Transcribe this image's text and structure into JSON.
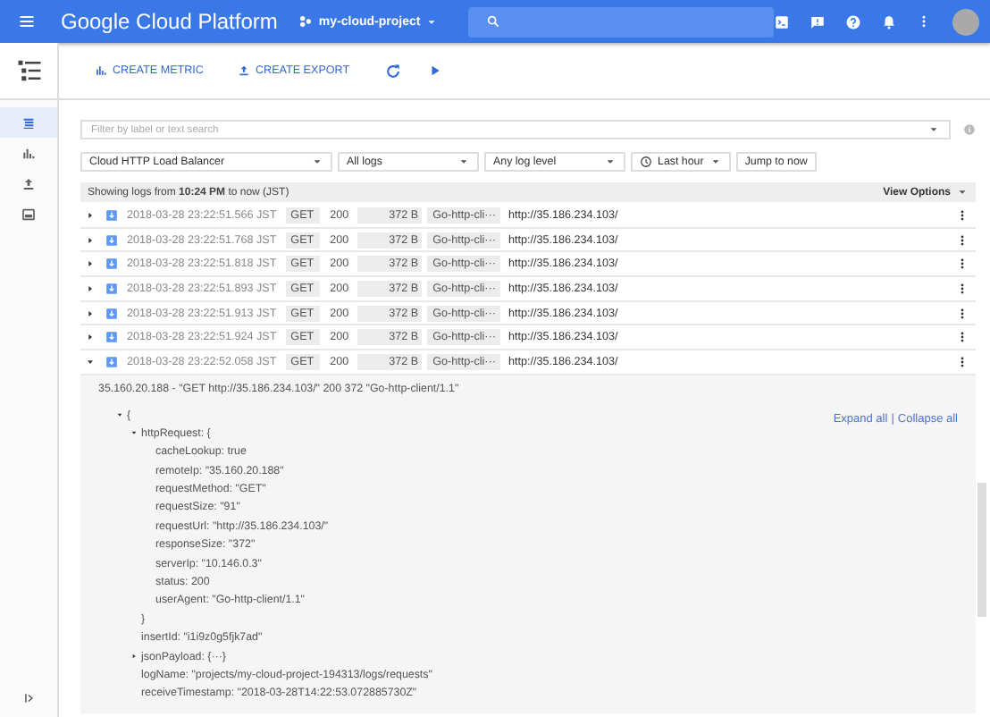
{
  "header": {
    "title": "Google Cloud Platform",
    "project": "my-cloud-project"
  },
  "toolbar": {
    "buttons": [
      {
        "label": "CREATE METRIC",
        "kind": "metric"
      },
      {
        "label": "CREATE EXPORT",
        "kind": "export"
      }
    ]
  },
  "sidebar": {
    "items": [
      {
        "kind": "logs",
        "selected": true
      },
      {
        "kind": "metrics",
        "selected": false
      },
      {
        "kind": "exports",
        "selected": false
      },
      {
        "kind": "resources",
        "selected": false
      }
    ]
  },
  "filter": {
    "placeholder": "Filter by label or text search"
  },
  "selectors": [
    {
      "label": "Cloud HTTP Load Balancer",
      "kind": "select"
    },
    {
      "label": "All logs",
      "kind": "select"
    },
    {
      "label": "Any log level",
      "kind": "select"
    },
    {
      "label": "Last hour",
      "kind": "time"
    },
    {
      "label": "Jump to now",
      "kind": "button"
    }
  ],
  "status_bar": {
    "text": "Showing logs from **10:24 PM** to now (JST)",
    "view_options": "View Options"
  },
  "rows": [
    {
      "timestamp": "2018-03-28 23:22:51.566 JST",
      "method": "GET",
      "status": "200",
      "size": "372 B",
      "agent": "Go-http-cli···",
      "url": "http://35.186.234.103/",
      "expanded": false
    },
    {
      "timestamp": "2018-03-28 23:22:51.768 JST",
      "method": "GET",
      "status": "200",
      "size": "372 B",
      "agent": "Go-http-cli···",
      "url": "http://35.186.234.103/",
      "expanded": false
    },
    {
      "timestamp": "2018-03-28 23:22:51.818 JST",
      "method": "GET",
      "status": "200",
      "size": "372 B",
      "agent": "Go-http-cli···",
      "url": "http://35.186.234.103/",
      "expanded": false
    },
    {
      "timestamp": "2018-03-28 23:22:51.893 JST",
      "method": "GET",
      "status": "200",
      "size": "372 B",
      "agent": "Go-http-cli···",
      "url": "http://35.186.234.103/",
      "expanded": false
    },
    {
      "timestamp": "2018-03-28 23:22:51.913 JST",
      "method": "GET",
      "status": "200",
      "size": "372 B",
      "agent": "Go-http-cli···",
      "url": "http://35.186.234.103/",
      "expanded": false
    },
    {
      "timestamp": "2018-03-28 23:22:51.924 JST",
      "method": "GET",
      "status": "200",
      "size": "372 B",
      "agent": "Go-http-cli···",
      "url": "http://35.186.234.103/",
      "expanded": false
    },
    {
      "timestamp": "2018-03-28 23:22:52.058 JST",
      "method": "GET",
      "status": "200",
      "size": "372 B",
      "agent": "Go-http-cli···",
      "url": "http://35.186.234.103/",
      "expanded": true
    }
  ],
  "detail": {
    "summary": "35.160.20.188 - \"GET http://35.186.234.103/\" 200 372 \"Go-http-client/1.1\"",
    "expand_all": "Expand all",
    "separator": "|",
    "collapse_all": "Collapse all",
    "tree": [
      {
        "text": "{",
        "expanded": true,
        "children": [
          {
            "text": "httpRequest: {",
            "expanded": true,
            "closing": "}",
            "children": [
              {
                "text": "cacheLookup: true"
              },
              {
                "text": "remoteIp: \"35.160.20.188\""
              },
              {
                "text": "requestMethod: \"GET\""
              },
              {
                "text": "requestSize: \"91\""
              },
              {
                "text": "requestUrl: \"http://35.186.234.103/\""
              },
              {
                "text": "responseSize: \"372\""
              },
              {
                "text": "serverIp: \"10.146.0.3\""
              },
              {
                "text": "status: 200"
              },
              {
                "text": "userAgent: \"Go-http-client/1.1\""
              }
            ]
          },
          {
            "text": "insertId: \"i1i9z0g5fjk7ad\""
          },
          {
            "text": "jsonPayload: {···}",
            "expanded": false
          },
          {
            "text": "logName: \"projects/my-cloud-project-194313/logs/requests\""
          },
          {
            "text": "receiveTimestamp: \"2018-03-28T14:22:53.072885730Z\""
          }
        ]
      }
    ]
  }
}
